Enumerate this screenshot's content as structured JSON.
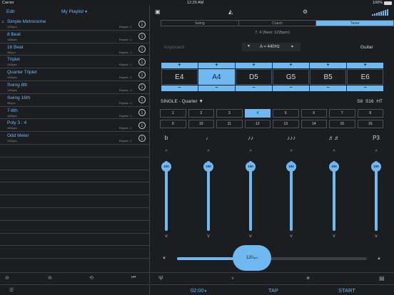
{
  "status_bar": {
    "carrier": "Carrier",
    "time": "12:29 AM",
    "battery": "100%"
  },
  "left": {
    "edit_label": "Edit",
    "playlist_label": "My Playlist",
    "items": [
      {
        "title": "Simple Metronome",
        "bpm": "120bpm",
        "repeat": "Repeat : 2",
        "playing": true
      },
      {
        "title": "8 Beat",
        "bpm": "146bpm",
        "repeat": "Repeat : 2"
      },
      {
        "title": "16 Beat",
        "bpm": "96bpm",
        "repeat": "Repeat : 2"
      },
      {
        "title": "Triplet",
        "bpm": "100bpm",
        "repeat": "Repeat : 2"
      },
      {
        "title": "Quarter Triplet",
        "bpm": "100bpm",
        "repeat": "Repeat : 2"
      },
      {
        "title": "Swing 8th",
        "bpm": "140bpm",
        "repeat": "Repeat : 2"
      },
      {
        "title": "Swing 16th",
        "bpm": "96bpm",
        "repeat": "Repeat : 2"
      },
      {
        "title": "7-8th",
        "bpm": "160bpm",
        "repeat": "Repeat : 2"
      },
      {
        "title": "Poly 3 : 4",
        "bpm": "100bpm",
        "repeat": "Repeat : 2"
      },
      {
        "title": "Odd Meter",
        "bpm": "120bpm",
        "repeat": "Repeat : 2"
      }
    ],
    "empty_rows": 9
  },
  "right": {
    "tabs": [
      {
        "label": "Swing",
        "active": false
      },
      {
        "label": "Coach",
        "active": false
      },
      {
        "label": "Tuner",
        "active": true
      }
    ],
    "next_line": "7. 4 (Next: 122bpm)",
    "keyboard_label": "Keyboard",
    "pitch_value": "A = 440Hz",
    "instrument": "Guitar",
    "strings": [
      {
        "note": "E4",
        "active": false
      },
      {
        "note": "A4",
        "active": true
      },
      {
        "note": "D5",
        "active": false
      },
      {
        "note": "G5",
        "active": false
      },
      {
        "note": "B5",
        "active": false
      },
      {
        "note": "E6",
        "active": false
      }
    ],
    "pattern_label": "SINGLE - Quarter",
    "flags": [
      "S8",
      "S16",
      "HT"
    ],
    "beat_cells": [
      "1",
      "2",
      "3",
      "4",
      "5",
      "6",
      "7",
      "8",
      "9",
      "10",
      "11",
      "12",
      "13",
      "14",
      "15",
      "16"
    ],
    "active_beat": "4",
    "voices": [
      {
        "symbol": "b",
        "volume": 100
      },
      {
        "symbol": "♩",
        "volume": 100
      },
      {
        "symbol": "♪♪",
        "volume": 100
      },
      {
        "symbol": "♪♪♪",
        "volume": 100
      },
      {
        "symbol": "♬♬",
        "volume": 100
      },
      {
        "symbol": "P3",
        "volume": 100
      }
    ],
    "tempo": {
      "value": "120",
      "unit": "bpm",
      "fraction": 0.38
    },
    "timer_label": "02:00",
    "tap_label": "TAP",
    "start_label": "START"
  }
}
